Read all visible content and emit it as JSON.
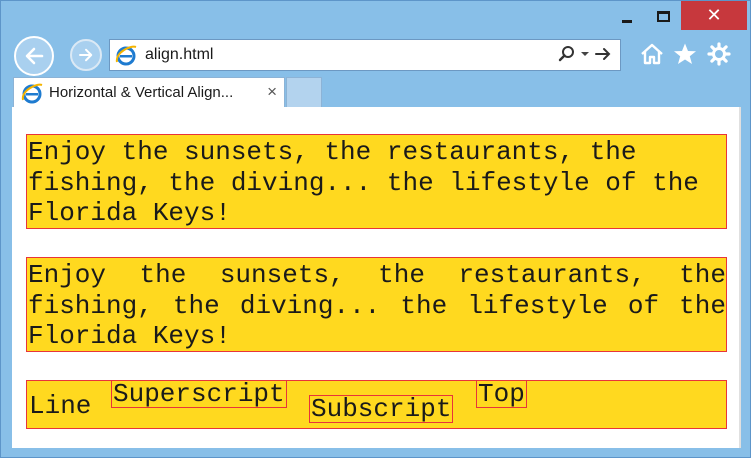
{
  "window": {
    "controls": {
      "minimize": "",
      "maximize": "",
      "close": "✕"
    }
  },
  "toolbar": {
    "url": "align.html",
    "icons": [
      "back-arrow-icon",
      "forward-arrow-icon",
      "ie-logo-icon",
      "search-icon",
      "dropdown-icon",
      "go-arrow-icon",
      "home-icon",
      "favorites-star-icon",
      "settings-gear-icon"
    ]
  },
  "tabs": [
    {
      "title": "Horizontal & Vertical Align...",
      "close": "×",
      "active": true
    }
  ],
  "content": {
    "paragraph_left": "Enjoy the sunsets, the restaurants, the fishing, the diving... the lifestyle of the Florida Keys!",
    "paragraph_justify": "Enjoy the sunsets, the restaurants, the fishing, the diving... the lifestyle of the Florida Keys!",
    "vertical_align": {
      "baseline": "Line",
      "superscript": "Superscript",
      "subscript": "Subscript",
      "top": "Top"
    }
  },
  "colors": {
    "frame": "#88bfe8",
    "close_button": "#c7383d",
    "demo_background": "#ffd91f",
    "demo_border": "#e8343a"
  }
}
